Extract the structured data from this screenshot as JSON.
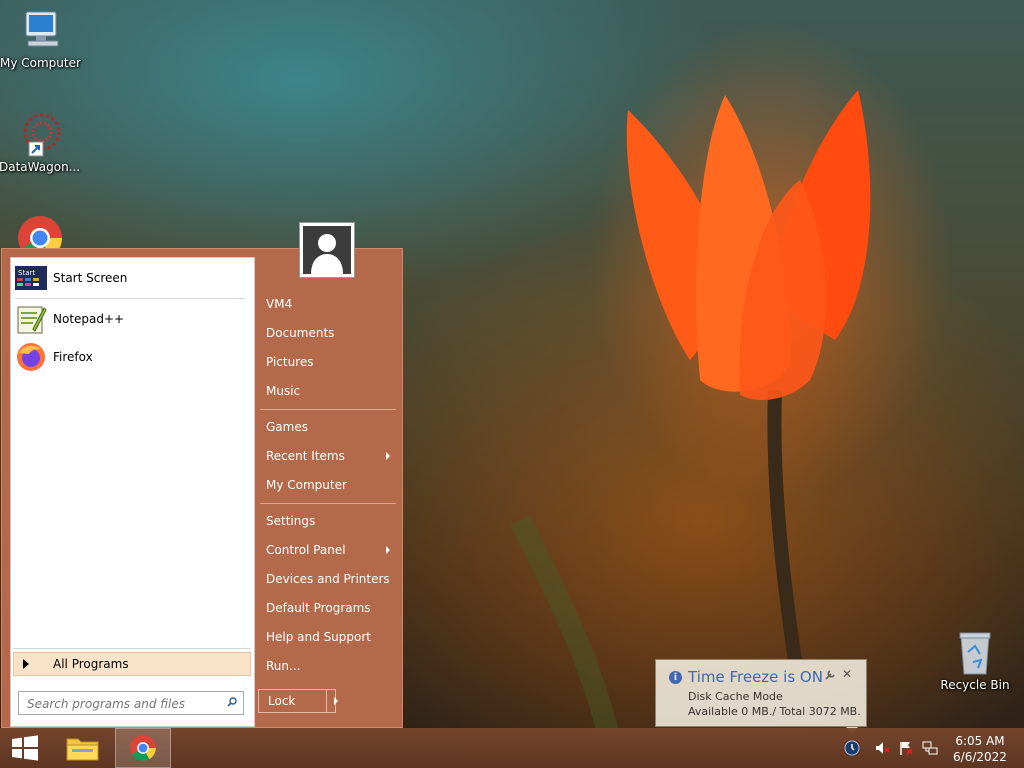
{
  "desktop": {
    "icons": [
      {
        "label": "My Computer",
        "icon": "my-computer-icon"
      },
      {
        "label": "DataWagon...",
        "icon": "datawagon-shortcut-icon"
      },
      {
        "label": "Recycle Bin",
        "icon": "recycle-bin-icon"
      }
    ]
  },
  "start_menu": {
    "programs": [
      {
        "label": "Start Screen",
        "icon": "start-screen-icon",
        "tile_text": "Start"
      },
      {
        "label": "Notepad++",
        "icon": "notepadpp-icon"
      },
      {
        "label": "Firefox",
        "icon": "firefox-icon"
      }
    ],
    "all_programs": "All Programs",
    "search_placeholder": "Search programs and files",
    "right_items": [
      {
        "label": "VM4"
      },
      {
        "label": "Documents"
      },
      {
        "label": "Pictures"
      },
      {
        "label": "Music"
      },
      {
        "label": "Games"
      },
      {
        "label": "Recent Items",
        "submenu": true
      },
      {
        "label": "My Computer"
      },
      {
        "label": "Settings"
      },
      {
        "label": "Control Panel",
        "submenu": true
      },
      {
        "label": "Devices and Printers"
      },
      {
        "label": "Default Programs"
      },
      {
        "label": "Help and Support"
      },
      {
        "label": "Run..."
      }
    ],
    "lock_label": "Lock"
  },
  "notification": {
    "title": "Time Freeze is ON",
    "line1": "Disk Cache Mode",
    "line2": "Available 0 MB./ Total 3072 MB."
  },
  "taskbar": {
    "clock_time": "6:05 AM",
    "clock_date": "6/6/2022"
  },
  "colors": {
    "start_menu_bg": "#b46a4a",
    "all_programs_bg": "#fbe3c9",
    "taskbar_bg": "#6e4230",
    "toast_title": "#3b6fc7"
  }
}
